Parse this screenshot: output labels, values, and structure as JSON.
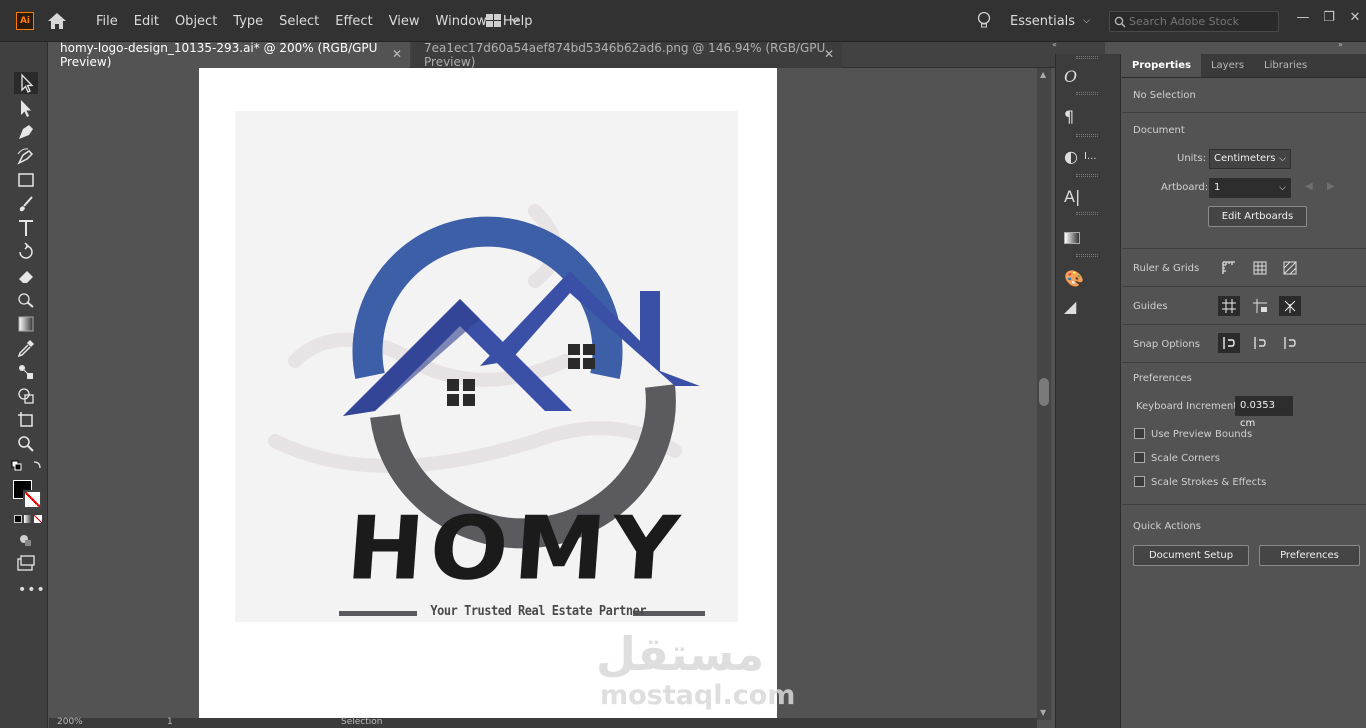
{
  "app": {
    "logo_text": "Ai"
  },
  "menu": [
    "File",
    "Edit",
    "Object",
    "Type",
    "Select",
    "Effect",
    "View",
    "Window",
    "Help"
  ],
  "workspace": {
    "label": "Essentials"
  },
  "search": {
    "placeholder": "Search Adobe Stock"
  },
  "tabs": [
    {
      "label": "homy-logo-design_10135-293.ai* @ 200% (RGB/GPU Preview)",
      "active": true
    },
    {
      "label": "7ea1ec17d60a54aef874bd5346b62ad6.png @ 146.94% (RGB/GPU Preview)",
      "active": false
    }
  ],
  "tools": [
    "selection-tool",
    "direct-selection-tool",
    "pen-tool",
    "curvature-tool",
    "rectangle-tool",
    "paintbrush-tool",
    "type-tool",
    "rotate-tool",
    "eraser-tool",
    "puppet-warp-tool",
    "gradient-tool",
    "eyedropper-tool",
    "blend-tool",
    "shape-builder-tool",
    "artboard-tool",
    "zoom-tool"
  ],
  "logo": {
    "brand": "HOMY",
    "tagline": "Your Trusted Real Estate Partner",
    "colors": {
      "ring_blue": "#3d5fa8",
      "ring_gray": "#5b5a5e",
      "roof_blue": "#3a4fa6",
      "text": "#1b1b1b"
    }
  },
  "watermark": {
    "arabic": "مستقل",
    "latin": "mostaql.com"
  },
  "statusbar": {
    "zoom": "200%",
    "artboard": "1",
    "tool": "Selection"
  },
  "properties": {
    "tabs": [
      "Properties",
      "Layers",
      "Libraries"
    ],
    "selection": "No Selection",
    "document_title": "Document",
    "units_label": "Units:",
    "units_value": "Centimeters",
    "artboard_label": "Artboard:",
    "artboard_value": "1",
    "edit_artboards": "Edit Artboards",
    "rulers_label": "Ruler & Grids",
    "guides_label": "Guides",
    "snap_label": "Snap Options",
    "preferences_title": "Preferences",
    "keyboard_increment_label": "Keyboard Increment:",
    "keyboard_increment_value": "0.0353 cm",
    "checkboxes": [
      "Use Preview Bounds",
      "Scale Corners",
      "Scale Strokes & Effects"
    ],
    "quick_actions_title": "Quick Actions",
    "document_setup": "Document Setup",
    "preferences_button": "Preferences"
  }
}
